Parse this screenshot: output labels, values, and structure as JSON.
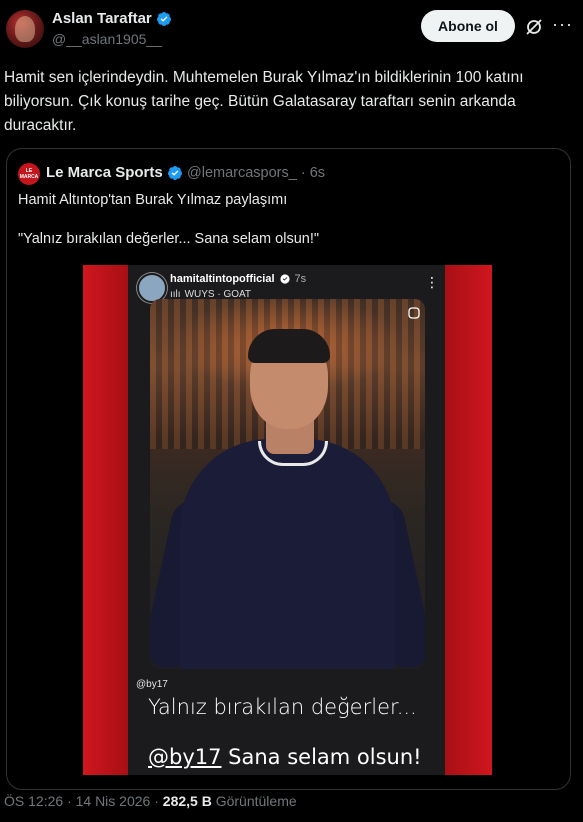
{
  "author": {
    "name": "Aslan Taraftar",
    "handle": "@__aslan1905__"
  },
  "actions": {
    "follow_label": "Abone ol"
  },
  "tweet": {
    "text": "Hamit sen içlerindeydin. Muhtemelen Burak Yılmaz'ın bildiklerinin 100 katını biliyorsun. Çık konuş tarihe geç. Bütün Galatasaray taraftarı senin arkanda duracaktır."
  },
  "quote": {
    "avatar_text": "LE MARCA",
    "name": "Le Marca Sports",
    "handle": "@lemarcaspors_",
    "time": "6s",
    "line1": "Hamit Altıntop'tan Burak Yılmaz paylaşımı",
    "line2": "\"Yalnız bırakılan değerler... Sana selam olsun!\"",
    "media": {
      "ig_username": "hamitaltintopofficial",
      "ig_time": "7s",
      "ig_music": "WUYS · GOAT",
      "caption_tag": "@by17",
      "caption_line1": "Yalnız bırakılan değerler...",
      "caption_mention": "@by17",
      "caption_line2": "Sana selam olsun!"
    }
  },
  "meta": {
    "time": "ÖS 12:26",
    "date": "14 Nis 2026",
    "views": "282,5 B",
    "views_label": "Görüntüleme"
  },
  "colors": {
    "background": "#000000",
    "verified": "#1d9bf0",
    "muted": "#71767b",
    "media_red": "#c0141b"
  }
}
